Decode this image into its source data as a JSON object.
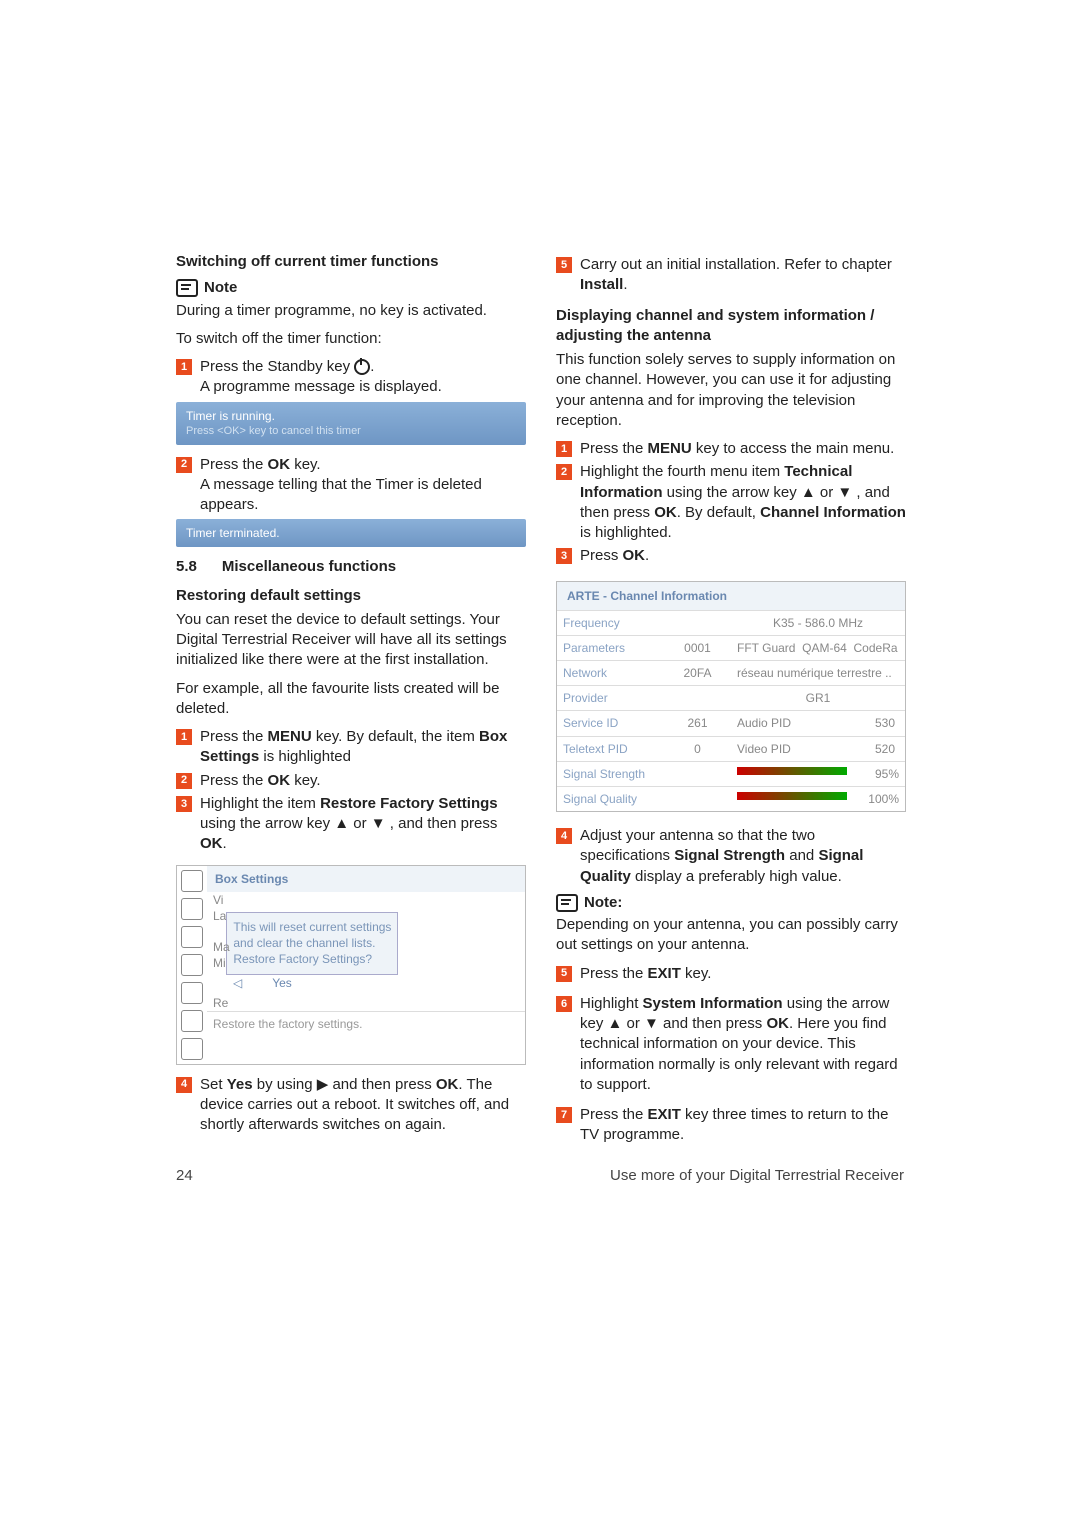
{
  "left": {
    "h1": "Switching off current timer functions",
    "note": "Note",
    "p1": "During a timer programme, no key is activated.",
    "p2": "To switch off the timer function:",
    "s1a": "Press the Standby key ",
    "s1b": ".",
    "s1c": "A programme message is displayed.",
    "msg1a": "Timer is running.",
    "msg1b": "Press <OK> key to cancel this timer",
    "s2a": "Press the ",
    "s2b": "OK",
    "s2c": " key.",
    "s2d": "A message telling that the Timer is deleted appears.",
    "msg2": "Timer terminated.",
    "sec": "5.8",
    "sect": "Miscellaneous functions",
    "h2": "Restoring default settings",
    "p3": "You can reset the device to default settings. Your Digital Terrestrial Receiver will have all its settings initialized like there were at the first installation.",
    "p4": "For example, all the favourite lists created will be deleted.",
    "r1a": "Press the ",
    "r1b": "MENU",
    "r1c": " key. By default, the item ",
    "r1d": "Box Settings",
    "r1e": " is highlighted",
    "r2a": "Press the ",
    "r2b": "OK",
    "r2c": " key.",
    "r3a": "Highlight the item ",
    "r3b": "Restore Factory Settings",
    "r3c": " using the arrow key ▲ or ▼ , and then press ",
    "r3d": "OK",
    "r3e": ".",
    "bs_title": "Box Settings",
    "bs_vi": "Vi",
    "bs_la": "La",
    "bs_ma": "Ma",
    "bs_mi": "Mi",
    "bs_re": "Re",
    "bs_pop1": "This will reset current settings",
    "bs_pop2": "and clear the channel lists.",
    "bs_pop3": "Restore Factory Settings?",
    "bs_b1": "◁",
    "bs_b2": "Yes",
    "bs_foot": "Restore the factory settings.",
    "r4a": "Set ",
    "r4b": "Yes",
    "r4c": " by using ▶ and then press ",
    "r4d": "OK",
    "r4e": ". The device carries out a reboot. It switches off, and shortly afterwards switches on again."
  },
  "right": {
    "s5a": "Carry out an initial installation. Refer to chapter ",
    "s5b": "Install",
    "s5c": ".",
    "h1": "Displaying channel and system information / adjusting the antenna",
    "p1": "This function solely serves to supply information on one channel. However, you can use it for adjusting your antenna and for improving the television reception.",
    "a1a": "Press the ",
    "a1b": "MENU",
    "a1c": " key to access the main menu.",
    "a2a": "Highlight the fourth menu item ",
    "a2b": "Technical Information",
    "a2c": " using the arrow key ▲ or ▼ , and then press ",
    "a2d": "OK",
    "a2e": ". By default, ",
    "a2f": "Channel Information",
    "a2g": " is highlighted.",
    "a3a": "Press ",
    "a3b": "OK",
    "a3c": ".",
    "ci_title": "ARTE - Channel Information",
    "ci": {
      "freq_l": "Frequency",
      "freq_v": "K35 - 586.0 MHz",
      "par_l": "Parameters",
      "par_v1": "0001",
      "par_v2": "FFT Guard",
      "par_v3": "QAM-64",
      "par_v4": "CodeRa",
      "net_l": "Network",
      "net_v1": "20FA",
      "net_v2": "réseau numérique terrestre ..",
      "pro_l": "Provider",
      "pro_v": "GR1",
      "sid_l": "Service ID",
      "sid_v": "261",
      "aud_l": "Audio PID",
      "aud_v": "530",
      "tt_l": "Teletext PID",
      "tt_v": "0",
      "vid_l": "Video PID",
      "vid_v": "520",
      "ss_l": "Signal Strength",
      "ss_v": "95%",
      "sq_l": "Signal Quality",
      "sq_v": "100%"
    },
    "a4a": "Adjust your antenna so that the two specifications ",
    "a4b": "Signal Strength",
    "a4c": " and ",
    "a4d": "Signal Quality",
    "a4e": " display a preferably high value.",
    "note": "Note",
    "p2": "Depending on your antenna, you can possibly carry out settings on your antenna.",
    "a5a": "Press the ",
    "a5b": "EXIT",
    "a5c": " key.",
    "a6a": "Highlight ",
    "a6b": "System Information",
    "a6c": " using the arrow key ▲ or ▼ and then press ",
    "a6d": "OK",
    "a6e": ". Here you find technical information on your device. This information normally is only relevant with regard to support.",
    "a7a": "Press the ",
    "a7b": "EXIT",
    "a7c": " key three times to return to the TV programme."
  },
  "pnum": "24",
  "footer": "Use more of your Digital Terrestrial Receiver"
}
